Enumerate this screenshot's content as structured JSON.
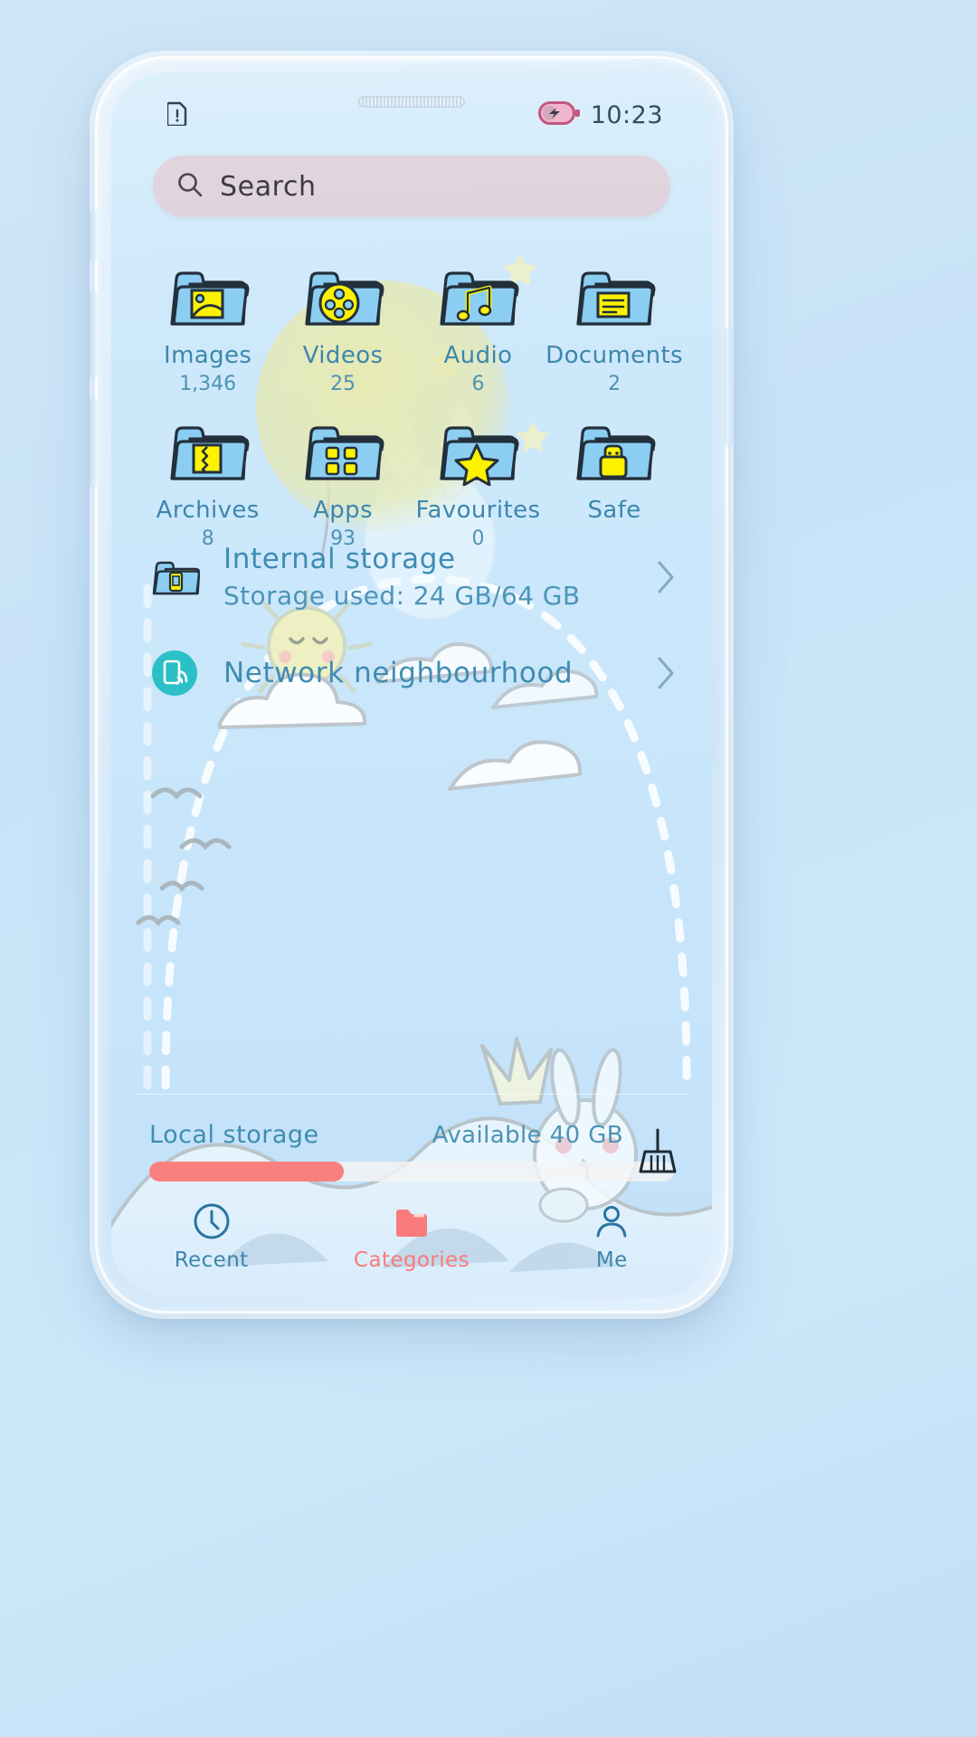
{
  "statusbar": {
    "sim_icon": "sim-alert-icon",
    "battery_icon": "battery-charging-icon",
    "time": "10:23"
  },
  "search": {
    "placeholder": "Search",
    "icon": "search-icon",
    "value": ""
  },
  "categories": [
    {
      "name": "Images",
      "count": "1,346",
      "icon": "folder-images-icon"
    },
    {
      "name": "Videos",
      "count": "25",
      "icon": "folder-videos-icon"
    },
    {
      "name": "Audio",
      "count": "6",
      "icon": "folder-audio-icon"
    },
    {
      "name": "Documents",
      "count": "2",
      "icon": "folder-documents-icon"
    },
    {
      "name": "Archives",
      "count": "8",
      "icon": "folder-archives-icon"
    },
    {
      "name": "Apps",
      "count": "93",
      "icon": "folder-apps-icon"
    },
    {
      "name": "Favourites",
      "count": "0",
      "icon": "folder-favourites-icon"
    },
    {
      "name": "Safe",
      "count": "",
      "icon": "folder-safe-icon"
    }
  ],
  "storage_rows": [
    {
      "title": "Internal storage",
      "subtitle": "Storage used: 24 GB/64 GB",
      "icon": "folder-device-icon",
      "chevron": "chevron-right-icon"
    },
    {
      "title": "Network neighbourhood",
      "subtitle": "",
      "icon": "network-share-icon",
      "chevron": "chevron-right-icon"
    }
  ],
  "local_storage": {
    "label": "Local storage",
    "available": "Available 40 GB",
    "used_percent": 37,
    "fill_color": "#fa8080",
    "clean_icon": "broom-icon"
  },
  "tabs": [
    {
      "label": "Recent",
      "icon": "clock-icon",
      "active": false
    },
    {
      "label": "Categories",
      "icon": "folder-icon",
      "active": true
    },
    {
      "label": "Me",
      "icon": "person-icon",
      "active": false
    }
  ],
  "theme": {
    "accent_blue": "#3f8cb2",
    "accent_coral": "#fa7b7b",
    "folder_blue": "#8ccdf2",
    "folder_yellow": "#fdf200",
    "search_bg": "#e2ced6"
  }
}
